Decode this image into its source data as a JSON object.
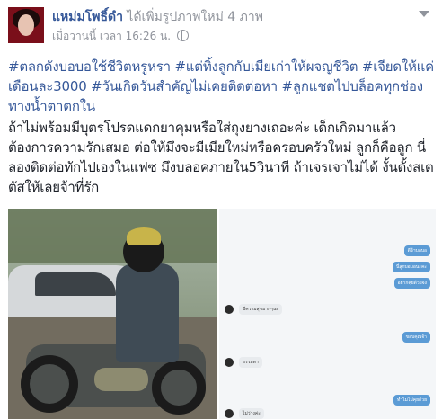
{
  "post": {
    "author": "แหม่มโพธิ์ดำ",
    "action": "ได้เพิ่มรูปภาพใหม่ 4 ภาพ",
    "timestamp": "เมื่อวานนี้ เวลา 16:26 น.",
    "hashtags": "#ตลกดังบอบอใช้ชีวิตหรูหรา #แต่ทิ้งลูกกับเมียเก่าให้ผจญชีวิต #เจียดให้แค่เดือนละ3000 #วันเกิดวันสำคัญไม่เคยติดต่อหา #ลูกแชตไปบล็อคทุกช่องทางน้ำตาตกใน",
    "body": "ถ้าไม่พร้อมมีบุตรโปรดแดกยาคุมหรือใส่ถุงยางเถอะค่ะ เด็กเกิดมาแล้วต้องการความรักเสมอ ต่อให้มึงจะมีเมียใหม่หรือครอบครัวใหม่ ลูกก็คือลูก นี่ลองติดต่อทักไปเองในแฟซ มึงบลอคภายใน5วินาที ถ้าเจรเจาไม่ได้ งั้นตั้งสเตตัสให้เลยจ้าที่รัก"
  },
  "chat_screenshot": {
    "messages": [
      {
        "side": "right",
        "text": "ดีจ้าบอบอ"
      },
      {
        "side": "right",
        "text": "นี่ลูกบอบอนะคะ"
      },
      {
        "side": "right",
        "text": "อยากคุยด้วยจัง"
      },
      {
        "side": "left",
        "text": "มีความสุขมากๆนะ"
      },
      {
        "side": "right",
        "text": "ขอบคุณจ้า"
      },
      {
        "side": "left",
        "text": "ธรรมดา"
      },
      {
        "side": "right",
        "text": "ทำไมไม่คุยด้วย"
      },
      {
        "side": "left",
        "text": "ไม่ว่างค่ะ"
      }
    ]
  }
}
